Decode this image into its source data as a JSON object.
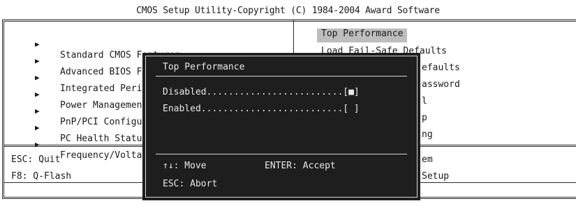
{
  "header": {
    "title": "CMOS Setup Utility-Copyright (C) 1984-2004 Award Software"
  },
  "left_menu": [
    {
      "label": "Standard CMOS Features"
    },
    {
      "label": "Advanced BIOS Features"
    },
    {
      "label": "Integrated Peri"
    },
    {
      "label": "Power Managemen"
    },
    {
      "label": "PnP/PCI Configu"
    },
    {
      "label": "PC Health Statu"
    },
    {
      "label": "Frequency/Volta"
    }
  ],
  "right_menu": [
    {
      "label": "Top Performance",
      "selected": true
    },
    {
      "label": "Load Fail-Safe Defaults"
    },
    {
      "label": "efaults"
    },
    {
      "label": "assword"
    },
    {
      "label": "l"
    },
    {
      "label": "p"
    },
    {
      "label": "ng"
    }
  ],
  "help": {
    "esc": "ESC: Quit",
    "f8": "F8: Q-Flash",
    "right1": "em",
    "right2": "Setup"
  },
  "popup": {
    "title": "Top Performance",
    "options": [
      {
        "text": "Disabled.........................[■]",
        "selected": true
      },
      {
        "text": "Enabled..........................[ ]",
        "selected": false
      }
    ],
    "move": "↑↓: Move",
    "accept": "ENTER: Accept",
    "abort": "ESC: Abort"
  },
  "colors": {
    "highlight": "#bdbdbd",
    "popup_bg": "#1e1e1e",
    "popup_text": "#e8e8e8"
  },
  "icons": {
    "bullet": "right-triangle-icon"
  }
}
